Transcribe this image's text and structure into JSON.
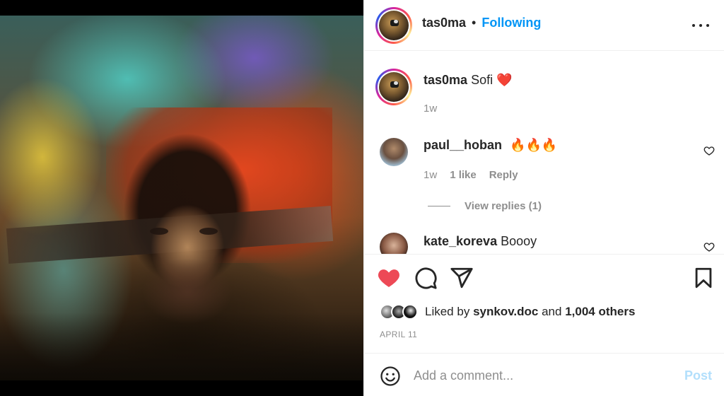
{
  "post": {
    "author": "tas0ma",
    "follow_status": "Following",
    "separator": "•",
    "caption": {
      "username": "tas0ma",
      "text": "Sofi",
      "emoji": "❤️",
      "time": "1w"
    },
    "comments": [
      {
        "username": "paul__hoban",
        "text": "🔥🔥🔥",
        "time": "1w",
        "likes": "1 like",
        "reply_label": "Reply",
        "view_replies": "View replies (1)"
      },
      {
        "username": "kate_koreva",
        "text": "Boooy"
      }
    ],
    "liked_by": {
      "prefix": "Liked by",
      "user": "synkov.doc",
      "conjunction": "and",
      "others": "1,004 others"
    },
    "date": "APRIL 11",
    "comment_placeholder": "Add a comment...",
    "post_label": "Post"
  },
  "icons": {
    "more": "more-options-icon",
    "like": "heart-icon",
    "comment": "comment-icon",
    "share": "share-icon",
    "save": "bookmark-icon",
    "emoji": "emoji-icon"
  },
  "colors": {
    "link": "#0095f6",
    "like_active": "#ed4956",
    "post_disabled": "#b2dffc",
    "meta": "#8e8e8e"
  }
}
